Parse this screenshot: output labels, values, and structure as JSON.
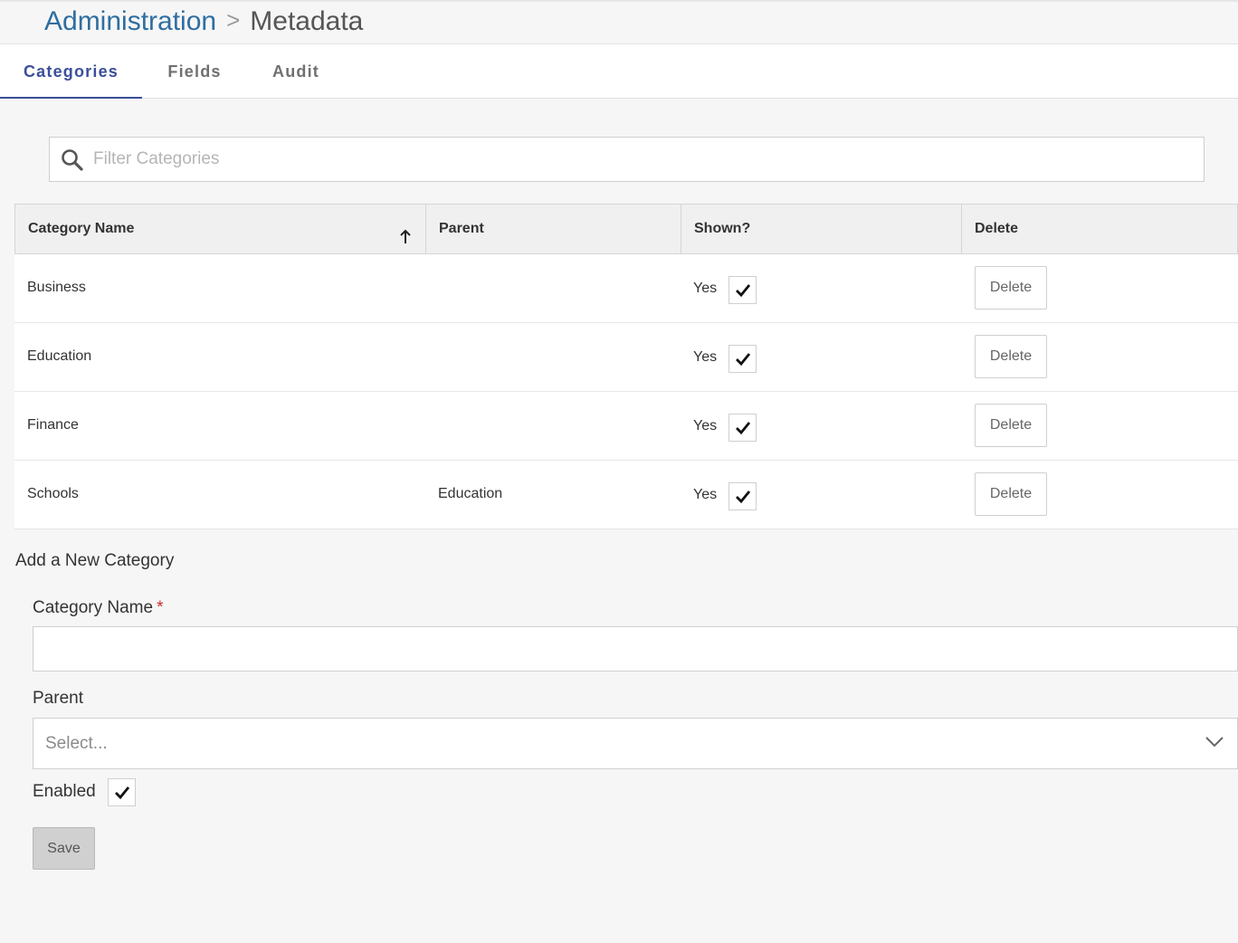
{
  "breadcrumb": {
    "parent": "Administration",
    "separator": ">",
    "current": "Metadata"
  },
  "tabs": [
    {
      "label": "Categories",
      "active": true
    },
    {
      "label": "Fields",
      "active": false
    },
    {
      "label": "Audit",
      "active": false
    }
  ],
  "search": {
    "placeholder": "Filter Categories",
    "value": "",
    "icon": "search-icon"
  },
  "table": {
    "columns": [
      "Category Name",
      "Parent",
      "Shown?",
      "Delete"
    ],
    "sort": {
      "column": "Category Name",
      "direction": "ascending",
      "icon": "arrow-up-icon"
    },
    "rows": [
      {
        "name": "Business",
        "parent": "",
        "shown_label": "Yes",
        "shown": true,
        "delete_label": "Delete"
      },
      {
        "name": "Education",
        "parent": "",
        "shown_label": "Yes",
        "shown": true,
        "delete_label": "Delete"
      },
      {
        "name": "Finance",
        "parent": "",
        "shown_label": "Yes",
        "shown": true,
        "delete_label": "Delete"
      },
      {
        "name": "Schools",
        "parent": "Education",
        "shown_label": "Yes",
        "shown": true,
        "delete_label": "Delete"
      }
    ]
  },
  "form": {
    "title": "Add a New Category",
    "name_label": "Category Name",
    "required_mark": "*",
    "name_value": "",
    "parent_label": "Parent",
    "parent_placeholder": "Select...",
    "enabled_label": "Enabled",
    "enabled": true,
    "save_label": "Save"
  },
  "colors": {
    "accent": "#3b4f9a",
    "link": "#2f6ea0",
    "required": "#c9302c"
  }
}
